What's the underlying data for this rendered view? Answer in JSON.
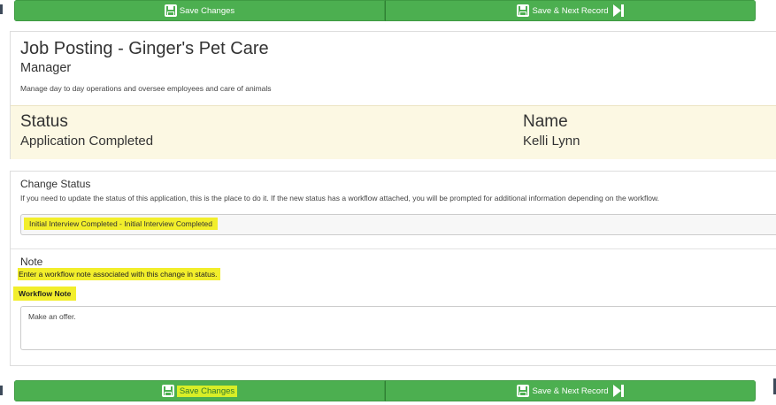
{
  "toolbar": {
    "save_label": "Save Changes",
    "save_next_label": "Save & Next Record"
  },
  "job": {
    "title": "Job Posting - Ginger's Pet Care",
    "role": "Manager",
    "description": "Manage day to day operations and oversee employees and care of animals"
  },
  "summary": {
    "status_label": "Status",
    "status_value": "Application Completed",
    "name_label": "Name",
    "name_value": "Kelli Lynn"
  },
  "change_status": {
    "title": "Change Status",
    "help": "If you need to update the status of this application, this is the place to do it. If the new status has a workflow attached, you will be prompted for additional information depending on the workflow.",
    "selected": "Initial Interview Completed - Initial Interview Completed"
  },
  "note": {
    "title": "Note",
    "help": "Enter a workflow note associated with this change in status.",
    "field_label": "Workflow Note",
    "value": "Make an offer."
  },
  "colors": {
    "button_green": "#4caf50",
    "highlight_yellow": "#f2ee2b",
    "status_band": "#fcf8e3"
  },
  "icons": {
    "save": "floppy-disk-icon",
    "next": "skip-forward-icon"
  }
}
